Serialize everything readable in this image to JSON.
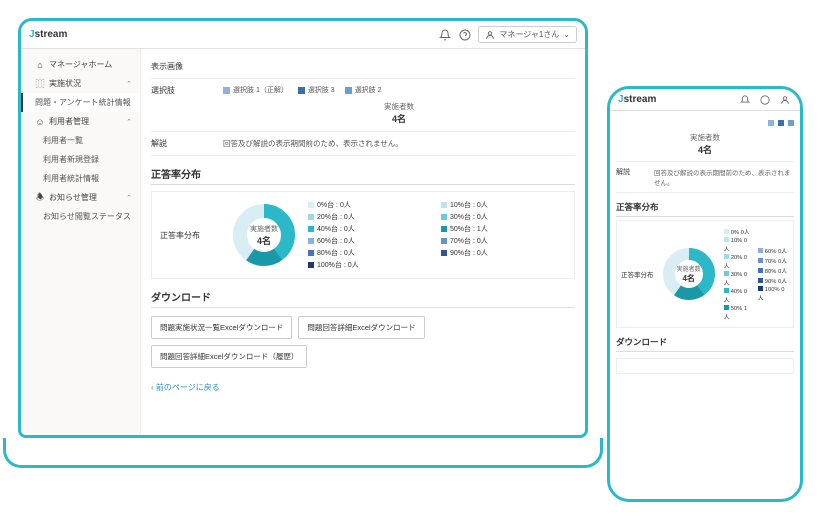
{
  "brand": {
    "name": "stream",
    "accent": "J"
  },
  "header": {
    "user_label": "マネージャ1さん",
    "icons": {
      "bell": "bell-icon",
      "help": "help-icon",
      "user": "user-icon"
    }
  },
  "sidebar": {
    "items": [
      {
        "label": "マネージャホーム",
        "icon": "home-icon"
      },
      {
        "label": "実施状況",
        "icon": "chart-icon",
        "expanded": true
      },
      {
        "label": "問題・アンケート統計情報",
        "sub": true,
        "active": true
      },
      {
        "label": "利用者管理",
        "icon": "user-icon",
        "expanded": true
      },
      {
        "label": "利用者一覧",
        "sub": true
      },
      {
        "label": "利用者新規登録",
        "sub": true
      },
      {
        "label": "利用者統計情報",
        "sub": true
      },
      {
        "label": "お知らせ管理",
        "icon": "bell-icon",
        "expanded": true
      },
      {
        "label": "お知らせ閲覧ステータス",
        "sub": true
      }
    ]
  },
  "detail": {
    "display_image_label": "表示画像",
    "options_label": "選択肢",
    "options": [
      {
        "label": "選択肢 1（正解）",
        "color": "#8cb4dc"
      },
      {
        "label": "選択肢 3",
        "color": "#3c6fb0"
      },
      {
        "label": "選択肢 2",
        "color": "#69a0d4"
      }
    ],
    "count_label": "実施者数",
    "count_value": "4名",
    "explanation_label": "解説",
    "explanation_text": "回答及び解説の表示期間前のため、表示されません。"
  },
  "distribution": {
    "title": "正答率分布",
    "row_label": "正答率分布",
    "count_label": "実施者数",
    "count_value": "4名"
  },
  "chart_data": {
    "type": "pie",
    "title": "正答率分布",
    "center_label": "実施者数",
    "center_value": "4名",
    "series": [
      {
        "name": "0%台",
        "value": 0,
        "unit": "人",
        "color": "#d9eef4"
      },
      {
        "name": "10%台",
        "value": 0,
        "unit": "人",
        "color": "#bfe4ee"
      },
      {
        "name": "20%台",
        "value": 0,
        "unit": "人",
        "color": "#9fd8e6"
      },
      {
        "name": "30%台",
        "value": 0,
        "unit": "人",
        "color": "#6cc8dc"
      },
      {
        "name": "40%台",
        "value": 0,
        "unit": "人",
        "color": "#2bb8c9"
      },
      {
        "name": "50%台",
        "value": 1,
        "unit": "人",
        "color": "#1a98a8"
      },
      {
        "name": "60%台",
        "value": 0,
        "unit": "人",
        "color": "#8eb0e0"
      },
      {
        "name": "70%台",
        "value": 0,
        "unit": "人",
        "color": "#6a8fd0"
      },
      {
        "name": "80%台",
        "value": 0,
        "unit": "人",
        "color": "#4a70b8"
      },
      {
        "name": "90%台",
        "value": 0,
        "unit": "人",
        "color": "#2f5498"
      },
      {
        "name": "100%台",
        "value": 0,
        "unit": "人",
        "color": "#1a3a78"
      }
    ]
  },
  "downloads": {
    "title": "ダウンロード",
    "buttons": [
      "問題実施状況一覧Excelダウンロード",
      "問題回答詳細Excelダウンロード",
      "問題回答詳細Excelダウンロード（履歴）"
    ]
  },
  "back_link": "‹ 前のページに戻る",
  "phone": {
    "explanation_text": "回答及び解説の表示期間前のため、表示されません。"
  }
}
